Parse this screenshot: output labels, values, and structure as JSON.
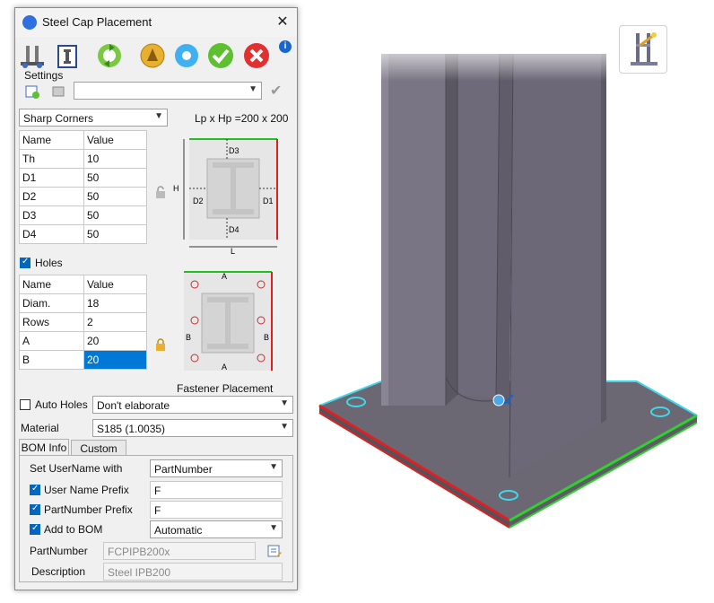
{
  "window": {
    "title": "Steel Cap Placement"
  },
  "icons": {
    "app": "app-logo-icon",
    "toolbar": [
      "steel-assembly-icon",
      "profile-select-icon",
      "refresh-icon",
      "hide-cap-icon",
      "apply-icon",
      "ok-icon",
      "cancel-icon",
      "help-icon"
    ],
    "settings": [
      "add-setting-icon",
      "delete-setting-icon",
      "save-setting-icon"
    ],
    "viewport_widget": "cap-placement-tool-icon"
  },
  "settings": {
    "label": "Settings",
    "value": ""
  },
  "corners": {
    "value": "Sharp Corners",
    "dims_label": "Lp x Hp =200 x 200"
  },
  "dims_table": {
    "headers": [
      "Name",
      "Value"
    ],
    "rows": [
      [
        "Th",
        "10"
      ],
      [
        "D1",
        "50"
      ],
      [
        "D2",
        "50"
      ],
      [
        "D3",
        "50"
      ],
      [
        "D4",
        "50"
      ]
    ]
  },
  "dims_diagram": {
    "D1": "D1",
    "D2": "D2",
    "D3": "D3",
    "D4": "D4",
    "H": "H",
    "L": "L"
  },
  "holes": {
    "label": "Holes",
    "checked": true,
    "headers": [
      "Name",
      "Value"
    ],
    "rows": [
      [
        "Diam.",
        "18"
      ],
      [
        "Rows",
        "2"
      ],
      [
        "A",
        "20"
      ],
      [
        "B",
        "20"
      ]
    ],
    "diagram": {
      "A": "A",
      "B": "B"
    }
  },
  "fastener": {
    "label": "Fastener Placement",
    "auto_label": "Auto Holes",
    "auto_checked": false,
    "value": "Don't elaborate"
  },
  "material": {
    "label": "Material",
    "value": "S185  (1.0035)"
  },
  "tabs": [
    "BOM Info",
    "Custom Info"
  ],
  "bom": {
    "set_username_label": "Set UserName with",
    "set_username_value": "PartNumber",
    "username_prefix_label": "User Name Prefix",
    "username_prefix_value": "F",
    "partnumber_prefix_label": "PartNumber Prefix",
    "partnumber_prefix_value": "F",
    "add_to_bom_label": "Add to BOM",
    "add_to_bom_value": "Automatic",
    "partnumber_label": "PartNumber",
    "partnumber_value": "FCPIPB200x",
    "description_label": "Description",
    "description_value": "Steel IPB200"
  },
  "colors": {
    "accent": "#0078d7",
    "steel": "#6f6a7a",
    "edge_red": "#e02020",
    "edge_green": "#30d030",
    "edge_cyan": "#40d8e8"
  }
}
